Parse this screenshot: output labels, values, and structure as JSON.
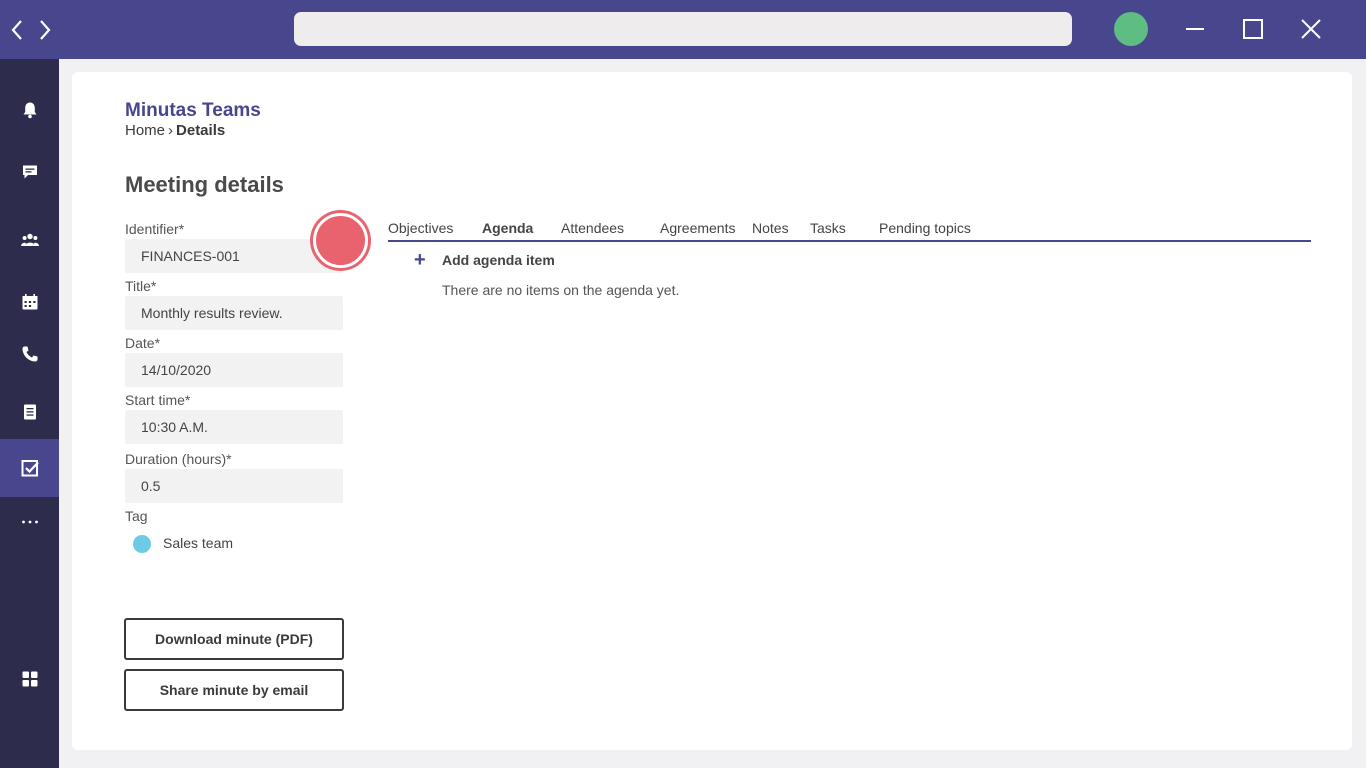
{
  "window": {
    "address_value": "",
    "colors": {
      "titlebar": "#48468c",
      "sidebar": "#2e2c4c",
      "avatar": "#5ebd82"
    }
  },
  "sidebar": {
    "items": [
      {
        "icon": "bell-icon"
      },
      {
        "icon": "chat-icon"
      },
      {
        "icon": "people-icon"
      },
      {
        "icon": "calendar-icon"
      },
      {
        "icon": "phone-icon"
      },
      {
        "icon": "document-icon"
      },
      {
        "icon": "checkbox-icon",
        "active": true
      },
      {
        "icon": "more-icon"
      },
      {
        "icon": "apps-icon"
      }
    ]
  },
  "header": {
    "app_title": "Minutas Teams",
    "breadcrumb_home": "Home",
    "breadcrumb_sep": "›",
    "breadcrumb_current": "Details"
  },
  "page": {
    "title": "Meeting details"
  },
  "form": {
    "identifier": {
      "label": "Identifier*",
      "value": "FINANCES-001"
    },
    "title": {
      "label": "Title*",
      "value": "Monthly results review."
    },
    "date": {
      "label": "Date*",
      "value": "14/10/2020"
    },
    "start_time": {
      "label": "Start time*",
      "value": "10:30 A.M."
    },
    "duration": {
      "label": "Duration (hours)*",
      "value": "0.5"
    },
    "tag": {
      "label": "Tag",
      "value": "Sales team",
      "color": "#6ecbe6"
    }
  },
  "actions": {
    "download": "Download minute (PDF)",
    "share": "Share minute by email"
  },
  "tabs": [
    {
      "label": "Objectives"
    },
    {
      "label": "Agenda",
      "active": true
    },
    {
      "label": "Attendees"
    },
    {
      "label": "Agreements"
    },
    {
      "label": "Notes"
    },
    {
      "label": "Tasks"
    },
    {
      "label": "Pending topics"
    }
  ],
  "agenda": {
    "add_symbol": "+",
    "add_label": "Add agenda item",
    "empty_message": "There are no items on the agenda yet."
  }
}
